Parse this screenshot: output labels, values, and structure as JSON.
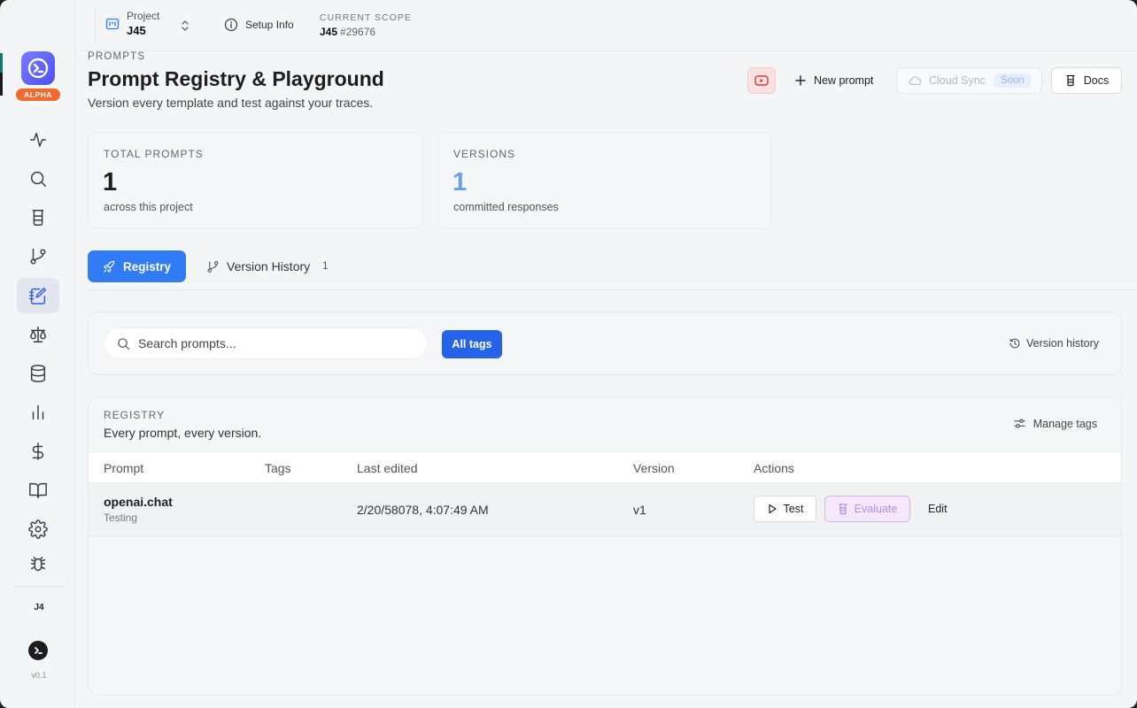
{
  "window": {
    "controls": [
      "close",
      "minimize",
      "zoom"
    ]
  },
  "sidebar": {
    "badge": "ALPHA",
    "items": [
      {
        "icon": "activity-icon",
        "active": false
      },
      {
        "icon": "search-icon",
        "active": false
      },
      {
        "icon": "beaker-icon",
        "active": false
      },
      {
        "icon": "git-branch-icon",
        "active": false
      },
      {
        "icon": "notebook-pen-icon",
        "active": true
      },
      {
        "icon": "scale-icon",
        "active": false
      },
      {
        "icon": "database-icon",
        "active": false
      },
      {
        "icon": "bar-chart-icon",
        "active": false
      },
      {
        "icon": "dollar-icon",
        "active": false
      },
      {
        "icon": "book-open-icon",
        "active": false
      },
      {
        "icon": "gear-icon",
        "active": false
      },
      {
        "icon": "bug-icon",
        "active": false
      }
    ],
    "workspace_label": "J4",
    "version": "v0.1"
  },
  "topbar": {
    "project_label": "Project",
    "project_value": "J45",
    "setup_info": "Setup Info",
    "scope_label": "CURRENT SCOPE",
    "scope_value": "J45",
    "scope_id": "#29676"
  },
  "header": {
    "eyebrow": "PROMPTS",
    "title": "Prompt Registry & Playground",
    "subtitle": "Version every template and test against your traces.",
    "new_prompt": "New prompt",
    "cloud_sync": "Cloud Sync",
    "soon": "Soon",
    "docs": "Docs"
  },
  "stats": [
    {
      "label": "TOTAL PROMPTS",
      "value": "1",
      "note": "across this project"
    },
    {
      "label": "VERSIONS",
      "value": "1",
      "note": "committed responses"
    }
  ],
  "tabs": {
    "registry": "Registry",
    "history": "Version History",
    "history_count": "1"
  },
  "search": {
    "placeholder": "Search prompts...",
    "all_tags": "All tags",
    "version_history": "Version history"
  },
  "registry": {
    "eyebrow": "REGISTRY",
    "subtitle": "Every prompt, every version.",
    "manage_tags": "Manage tags",
    "columns": [
      "Prompt",
      "Tags",
      "Last edited",
      "Version",
      "Actions"
    ],
    "rows": [
      {
        "name": "openai.chat",
        "sub": "Testing",
        "tags": "",
        "last_edited": "2/20/58078, 4:07:49 AM",
        "version": "v1",
        "actions": {
          "test": "Test",
          "evaluate": "Evaluate",
          "edit": "Edit"
        }
      }
    ]
  },
  "colors": {
    "primary": "#2f7cf6",
    "all_tags": "#2563eb",
    "evaluate_bg": "#f3e8fc",
    "alpha_badge": "#f26a2b",
    "versions_value": "#6aa0e6"
  }
}
